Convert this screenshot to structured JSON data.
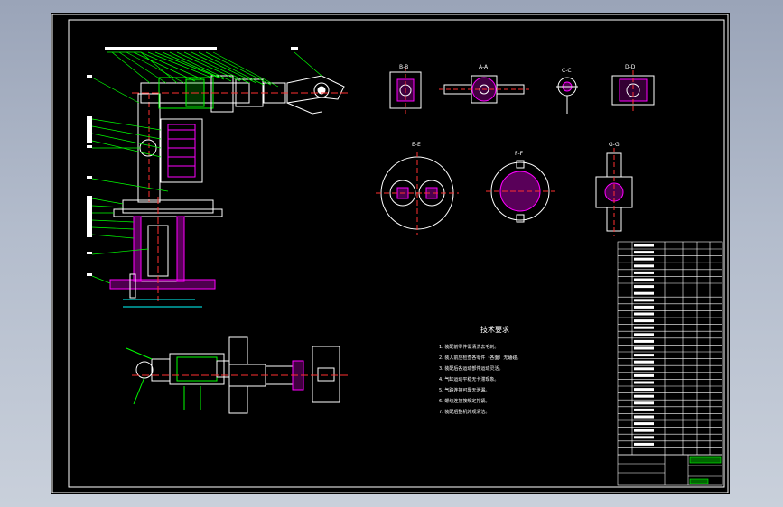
{
  "drawing": {
    "tech_req_title": "技术要求",
    "tech_req_lines": [
      "1. 装配前零件需清洗去毛刺。",
      "2. 装入前应检查各零件（各面）无磕碰。",
      "3. 装配后各运动部件运动灵活。",
      "4. 气缸运动平稳无卡滞现象。",
      "5. 气路连接可靠无泄漏。",
      "6. 螺纹连接按规定拧紧。",
      "7. 装配后整机外观清洁。"
    ],
    "view_labels": [
      "B-B",
      "A-A",
      "C-C",
      "D-D",
      "E-E",
      "F-F",
      "G-G"
    ],
    "colors": {
      "background": "#000000",
      "frame": "#ffffff",
      "part_outline": "#ffffff",
      "leader": "#00ff00",
      "hatch": "#ff00ff",
      "dimension": "#00ffff",
      "centerline": "#ff3030",
      "text": "#ffffff"
    }
  }
}
